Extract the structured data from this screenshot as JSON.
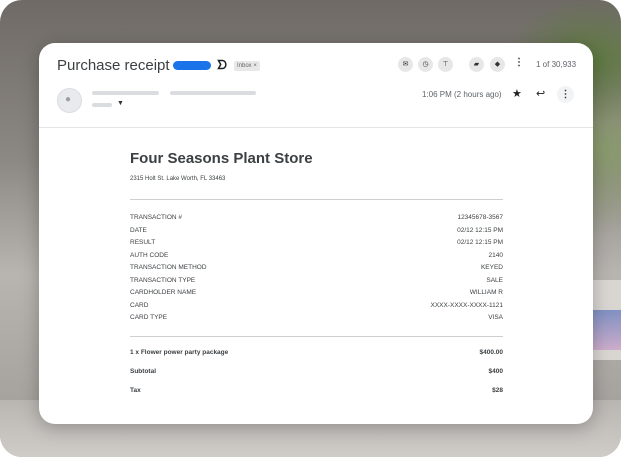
{
  "email": {
    "subject": "Purchase receipt",
    "label_color": "#1a73e8",
    "inbox_chip": "Inbox ×",
    "counter": "1 of 30,933",
    "time": "1:06 PM (2 hours ago)",
    "icons": {
      "toolbar": [
        "mail-icon",
        "clock-icon",
        "pin-icon",
        "folder-icon",
        "tag-icon",
        "more-vert-icon"
      ],
      "actions": [
        "star-icon",
        "reply-icon",
        "more-vert-icon"
      ]
    }
  },
  "receipt": {
    "store_name": "Four Seasons Plant Store",
    "address": "2315 Holt St. Lake Worth, FL 33463",
    "details": [
      {
        "label": "TRANSACTION #",
        "value": "12345678-3567"
      },
      {
        "label": "DATE",
        "value": "02/12 12:15 PM"
      },
      {
        "label": "RESULT",
        "value": "02/12 12:15 PM"
      },
      {
        "label": "AUTH CODE",
        "value": "2140"
      },
      {
        "label": "TRANSACTION METHOD",
        "value": "KEYED"
      },
      {
        "label": "TRANSACTION TYPE",
        "value": "SALE"
      },
      {
        "label": "CARDHOLDER NAME",
        "value": "WILLIAM R"
      },
      {
        "label": "CARD",
        "value": "XXXX-XXXX-XXXX-1121"
      },
      {
        "label": "CARD TYPE",
        "value": "VISA"
      }
    ],
    "item": {
      "label": "1 x Flower power party package",
      "value": "$400.00"
    },
    "subtotal": {
      "label": "Subtotal",
      "value": "$400"
    },
    "tax": {
      "label": "Tax",
      "value": "$28"
    }
  }
}
